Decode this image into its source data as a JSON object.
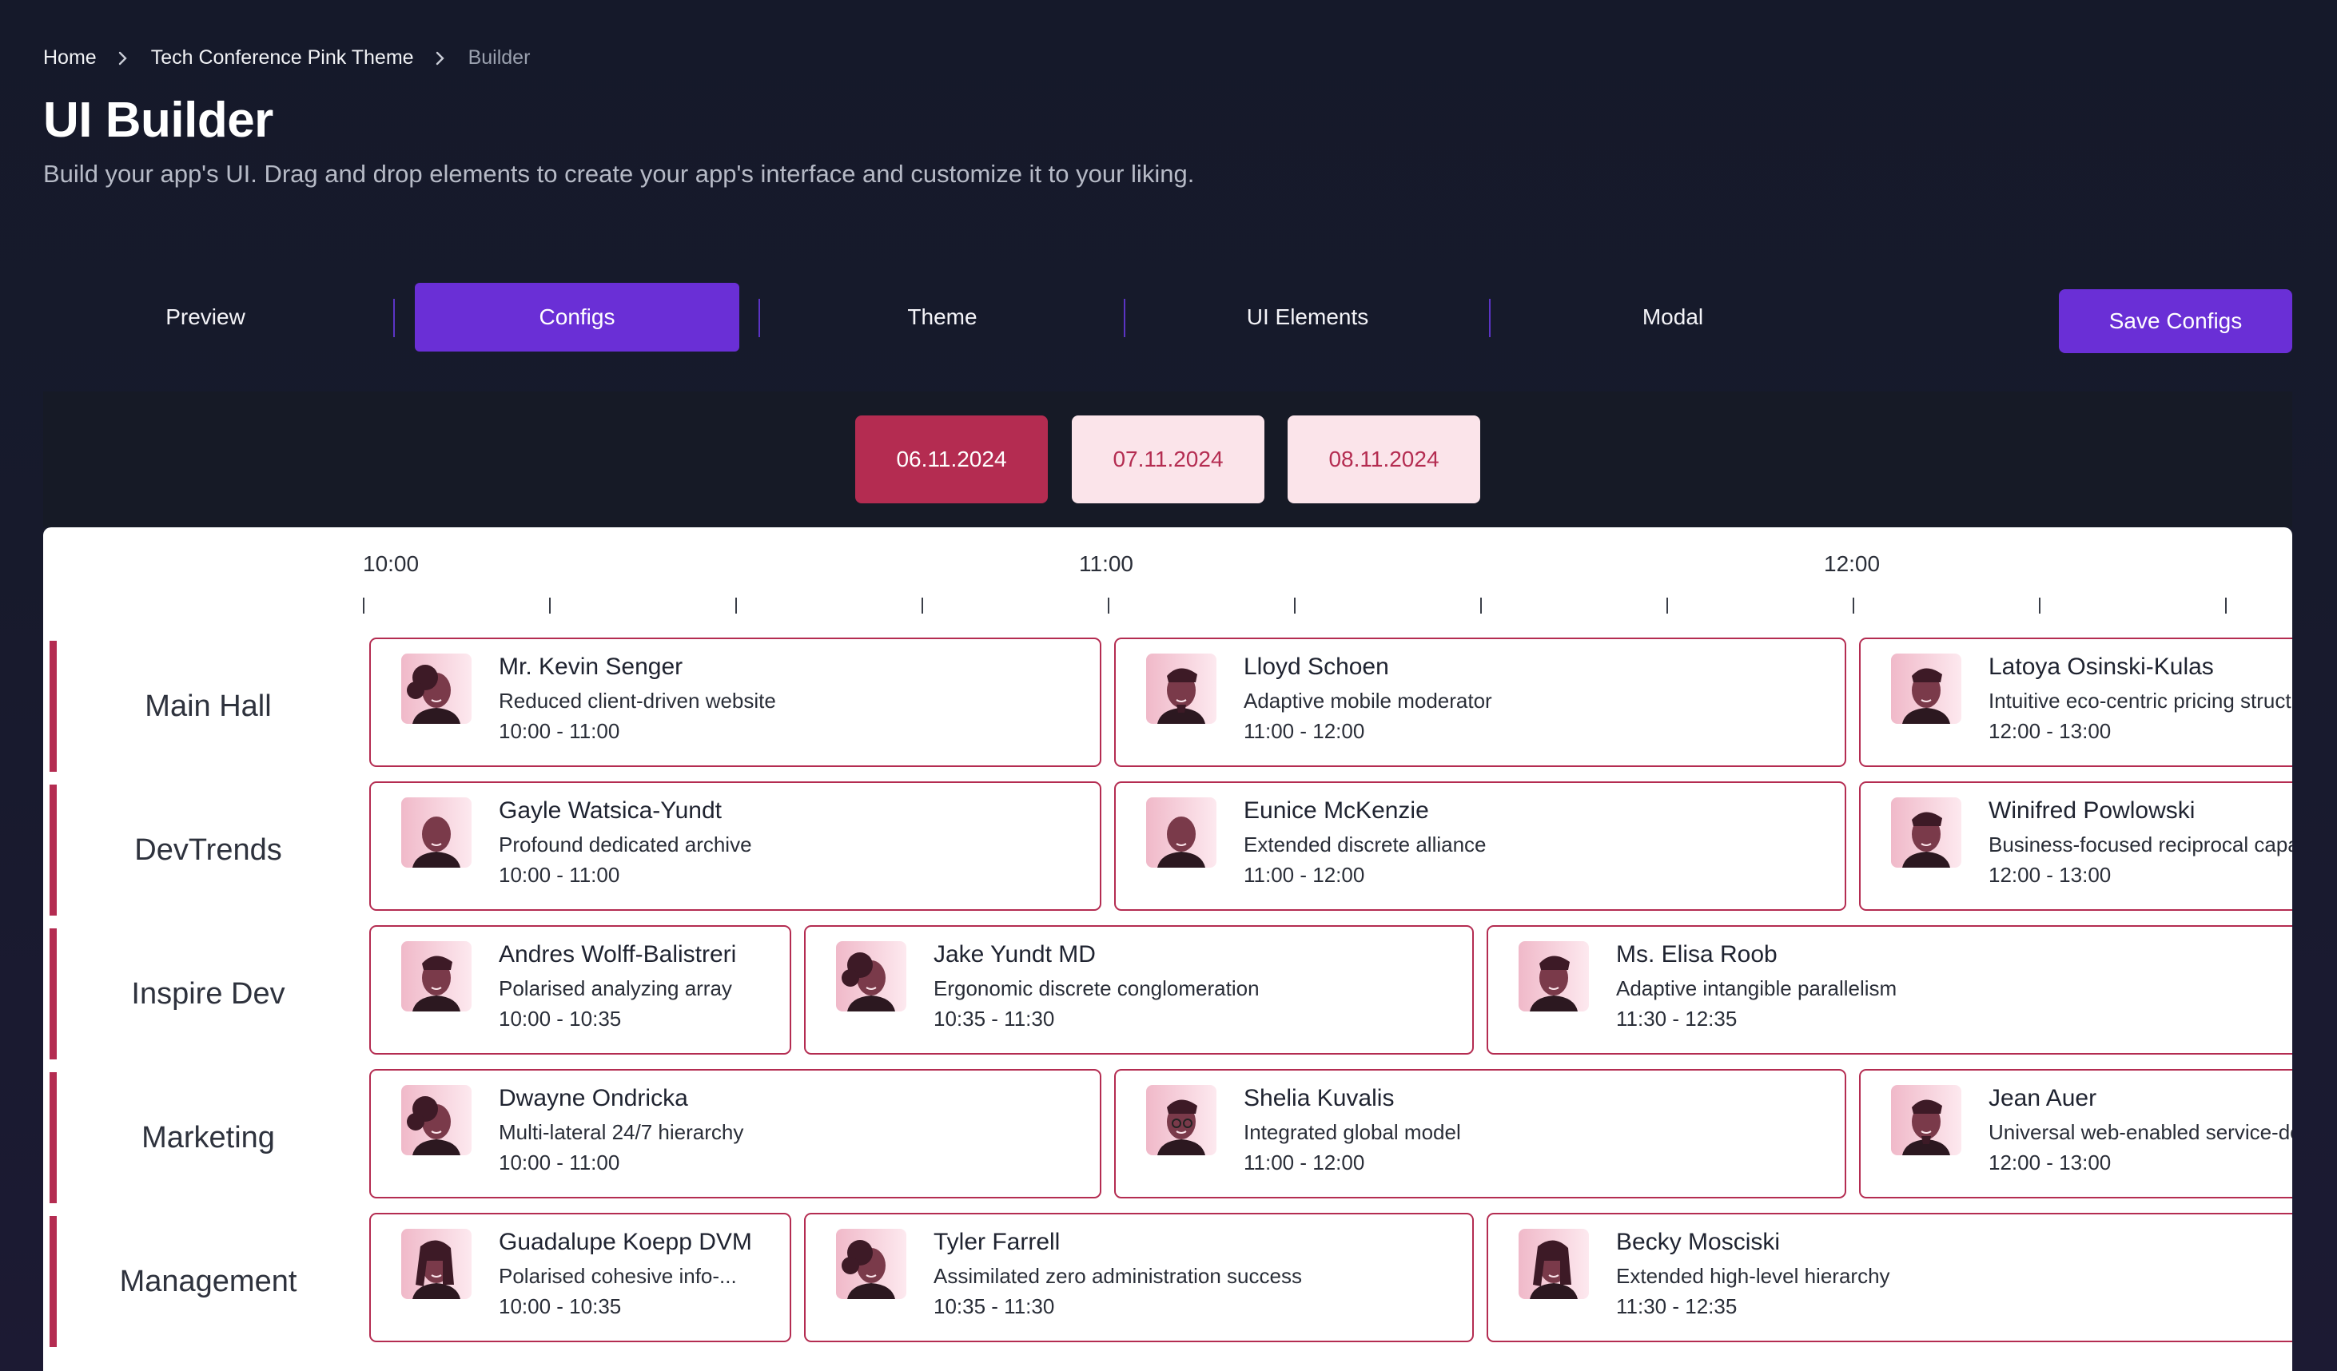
{
  "breadcrumb": {
    "home": "Home",
    "project": "Tech Conference Pink Theme",
    "current": "Builder"
  },
  "header": {
    "title": "UI Builder",
    "subtitle": "Build your app's UI. Drag and drop elements to create your app's interface and customize it to your liking."
  },
  "tabs": [
    {
      "label": "Preview"
    },
    {
      "label": "Configs"
    },
    {
      "label": "Theme"
    },
    {
      "label": "UI Elements"
    },
    {
      "label": "Modal"
    }
  ],
  "active_tab": "Configs",
  "save_label": "Save Configs",
  "dates": [
    "06.11.2024",
    "07.11.2024",
    "08.11.2024"
  ],
  "selected_date": "06.11.2024",
  "timeline": [
    "10:00",
    "11:00",
    "12:00"
  ],
  "colors": {
    "accent": "#6a2fd6",
    "brand": "#b42c51",
    "brand_light": "#fbe4ea"
  },
  "rooms": [
    {
      "name": "Main Hall",
      "sessions": [
        {
          "speaker": "Mr. Kevin Senger",
          "title": "Reduced client-driven website",
          "time": "10:00 - 11:00",
          "avatar": "avatar-curly-hair-icon"
        },
        {
          "speaker": "Lloyd Schoen",
          "title": "Adaptive mobile moderator",
          "time": "11:00 - 12:00",
          "avatar": "avatar-goatee-icon"
        },
        {
          "speaker": "Latoya Osinski-Kulas",
          "title": "Intuitive eco-centric pricing structure",
          "time": "12:00 - 13:00",
          "avatar": "avatar-short-hair-icon"
        }
      ]
    },
    {
      "name": "DevTrends",
      "sessions": [
        {
          "speaker": "Gayle Watsica-Yundt",
          "title": "Profound dedicated archive",
          "time": "10:00 - 11:00",
          "avatar": "avatar-bald-icon"
        },
        {
          "speaker": "Eunice McKenzie",
          "title": "Extended discrete alliance",
          "time": "11:00 - 12:00",
          "avatar": "avatar-bald-icon"
        },
        {
          "speaker": "Winifred Powlowski",
          "title": "Business-focused reciprocal capability",
          "time": "12:00 - 13:00",
          "avatar": "avatar-short-hair-icon"
        }
      ]
    },
    {
      "name": "Inspire Dev",
      "sessions": [
        {
          "speaker": "Andres Wolff-Balistreri",
          "title": "Polarised analyzing array",
          "time": "10:00 - 10:35",
          "avatar": "avatar-short-hair-icon"
        },
        {
          "speaker": "Jake Yundt MD",
          "title": "Ergonomic discrete conglomeration",
          "time": "10:35 - 11:30",
          "avatar": "avatar-curly-hair-icon"
        },
        {
          "speaker": "Ms. Elisa Roob",
          "title": "Adaptive intangible parallelism",
          "time": "11:30 - 12:35",
          "avatar": "avatar-short-hair-icon"
        }
      ]
    },
    {
      "name": "Marketing",
      "sessions": [
        {
          "speaker": "Dwayne Ondricka",
          "title": "Multi-lateral 24/7 hierarchy",
          "time": "10:00 - 11:00",
          "avatar": "avatar-curly-hair-icon"
        },
        {
          "speaker": "Shelia Kuvalis",
          "title": "Integrated global model",
          "time": "11:00 - 12:00",
          "avatar": "avatar-glasses-icon"
        },
        {
          "speaker": "Jean Auer",
          "title": "Universal web-enabled service-desk",
          "time": "12:00 - 13:00",
          "avatar": "avatar-goatee-icon"
        }
      ]
    },
    {
      "name": "Management",
      "sessions": [
        {
          "speaker": "Guadalupe Koepp DVM",
          "title": "Polarised cohesive info-...",
          "time": "10:00 - 10:35",
          "avatar": "avatar-long-hair-icon"
        },
        {
          "speaker": "Tyler Farrell",
          "title": "Assimilated zero administration success",
          "time": "10:35 - 11:30",
          "avatar": "avatar-curly-hair-icon"
        },
        {
          "speaker": "Becky Mosciski",
          "title": "Extended high-level hierarchy",
          "time": "11:30 - 12:35",
          "avatar": "avatar-long-hair-icon"
        }
      ]
    }
  ]
}
